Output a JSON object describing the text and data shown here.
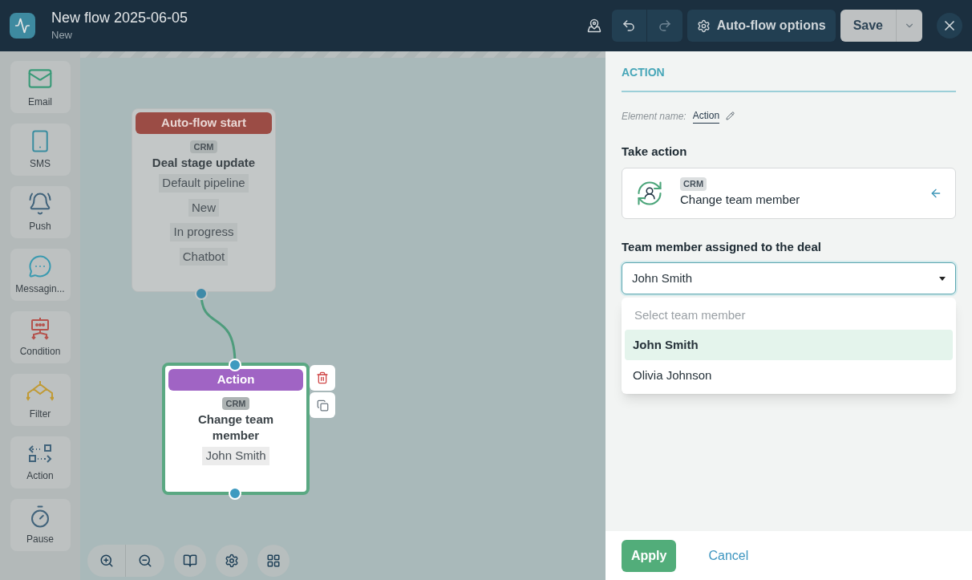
{
  "header": {
    "title": "New flow 2025-06-05",
    "subtitle": "New",
    "options_button": "Auto-flow options",
    "save_button": "Save",
    "redo_disabled": true
  },
  "palette": [
    {
      "kind": "email",
      "label": "Email"
    },
    {
      "kind": "sms",
      "label": "SMS"
    },
    {
      "kind": "push",
      "label": "Push"
    },
    {
      "kind": "messaging",
      "label": "Messagin..."
    },
    {
      "kind": "condition",
      "label": "Condition"
    },
    {
      "kind": "filter",
      "label": "Filter"
    },
    {
      "kind": "action",
      "label": "Action"
    },
    {
      "kind": "pause",
      "label": "Pause"
    }
  ],
  "nodes": [
    {
      "kind": "start",
      "header": "Auto-flow start",
      "tag": "CRM",
      "title": "Deal stage update",
      "chips": [
        "Default pipeline",
        "New",
        "In progress",
        "Chatbot"
      ],
      "selected": false
    },
    {
      "kind": "action",
      "header": "Action",
      "tag": "CRM",
      "title": "Change team member",
      "chips": [
        "John Smith"
      ],
      "selected": true
    }
  ],
  "panel": {
    "section_title": "ACTION",
    "element_name_label": "Element name:",
    "element_name": "Action",
    "take_action_label": "Take action",
    "action_card": {
      "tag": "CRM",
      "title": "Change team member"
    },
    "field_label": "Team member assigned to the deal",
    "select": {
      "value": "John Smith",
      "expanded": true,
      "empty_option": "Select team member",
      "options": [
        {
          "label": "John Smith",
          "selected": true
        },
        {
          "label": "Olivia Johnson",
          "selected": false
        }
      ]
    },
    "apply_button": "Apply",
    "cancel_button": "Cancel"
  }
}
